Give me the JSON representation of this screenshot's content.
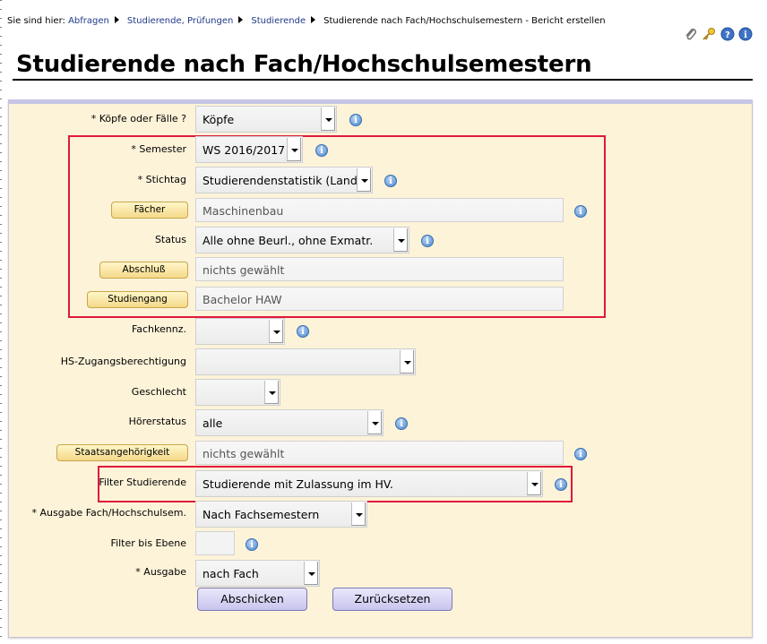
{
  "breadcrumb": {
    "prefix": "Sie sind hier:",
    "links": [
      "Abfragen",
      "Studierende, Prüfungen",
      "Studierende"
    ],
    "current": "Studierende nach Fach/Hochschulsemestern - Bericht erstellen"
  },
  "toolbar_icons": [
    "paperclip-icon",
    "key-icon",
    "help-icon",
    "info-icon"
  ],
  "page_title": "Studierende nach Fach/Hochschulsemestern",
  "form": {
    "koepfe": {
      "label": "* Köpfe oder Fälle ?",
      "value": "Köpfe"
    },
    "semester": {
      "label": "* Semester",
      "value": "WS 2016/2017"
    },
    "stichtag": {
      "label": "* Stichtag",
      "value": "Studierendenstatistik (Land)"
    },
    "faecher": {
      "label": "Fächer",
      "value": "Maschinenbau"
    },
    "status": {
      "label": "Status",
      "value": "Alle ohne Beurl., ohne Exmatr."
    },
    "abschluss": {
      "label": "Abschluß",
      "value": "nichts gewählt"
    },
    "studiengang": {
      "label": "Studiengang",
      "value": "Bachelor HAW"
    },
    "fachkennz": {
      "label": "Fachkennz.",
      "value": ""
    },
    "hs_zugang": {
      "label": "HS-Zugangsberechtigung",
      "value": ""
    },
    "geschlecht": {
      "label": "Geschlecht",
      "value": ""
    },
    "hoererstatus": {
      "label": "Hörerstatus",
      "value": "alle"
    },
    "staatsangehoerigkeit": {
      "label": "Staatsangehörigkeit",
      "value": "nichts gewählt"
    },
    "filter_studierende": {
      "label": "Filter Studierende",
      "value": "Studierende mit Zulassung im HV."
    },
    "ausgabe_fach": {
      "label": "* Ausgabe Fach/Hochschulsem.",
      "value": "Nach Fachsemestern"
    },
    "filter_ebene": {
      "label": "Filter bis Ebene",
      "value": ""
    },
    "ausgabe": {
      "label": "* Ausgabe",
      "value": "nach Fach"
    }
  },
  "buttons": {
    "submit": "Abschicken",
    "reset": "Zurücksetzen"
  },
  "info_glyph": "i",
  "colors": {
    "panel_bg": "#fdf3d9",
    "highlight_box": "#e0183c",
    "button_bg": "#c9c5ee",
    "link": "#1f3a8a"
  }
}
